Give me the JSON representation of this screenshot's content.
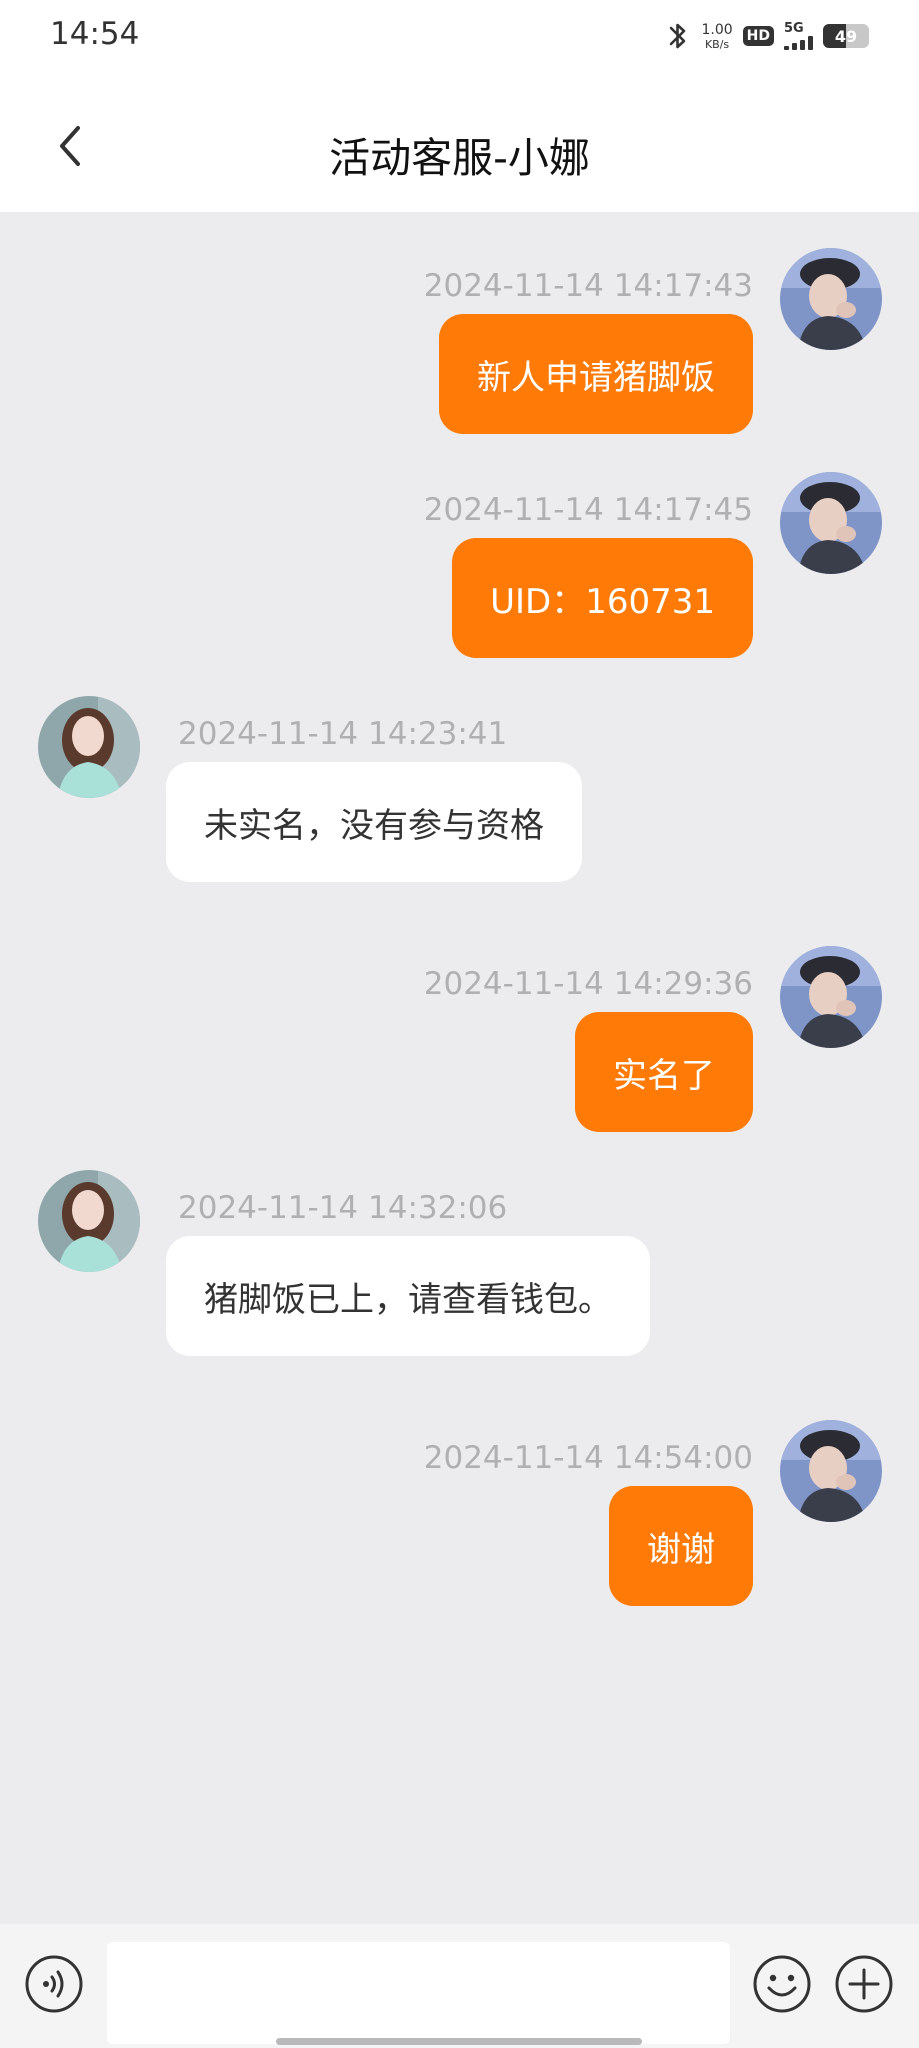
{
  "status_bar": {
    "time": "14:54",
    "network_speed_value": "1.00",
    "network_speed_unit": "KB/s",
    "hd_label": "HD",
    "signal_label": "5G",
    "battery_level": "49",
    "battery_fraction": 0.49,
    "icons": [
      "bluetooth-icon",
      "hd-icon",
      "signal-icon",
      "battery-icon"
    ]
  },
  "header": {
    "title": "活动客服-小娜",
    "back_icon": "chevron-left-icon"
  },
  "messages": [
    {
      "side": "right",
      "timestamp": "2024-11-14 14:17:43",
      "text": "新人申请猪脚饭"
    },
    {
      "side": "right",
      "timestamp": "2024-11-14 14:17:45",
      "text": "UID：160731"
    },
    {
      "side": "left",
      "timestamp": "2024-11-14 14:23:41",
      "text": "未实名，没有参与资格"
    },
    {
      "side": "right",
      "timestamp": "2024-11-14 14:29:36",
      "text": "实名了"
    },
    {
      "side": "left",
      "timestamp": "2024-11-14 14:32:06",
      "text": "猪脚饭已上，请查看钱包。"
    },
    {
      "side": "right",
      "timestamp": "2024-11-14 14:54:00",
      "text": "谢谢"
    }
  ],
  "colors": {
    "accent": "#ff7a06",
    "chat_background": "#ececee",
    "received_bubble": "#ffffff",
    "timestamp": "#b0b0b2"
  },
  "input_bar": {
    "text_value": "",
    "voice_icon": "voice-icon",
    "emoji_icon": "emoji-icon",
    "plus_icon": "plus-icon"
  }
}
